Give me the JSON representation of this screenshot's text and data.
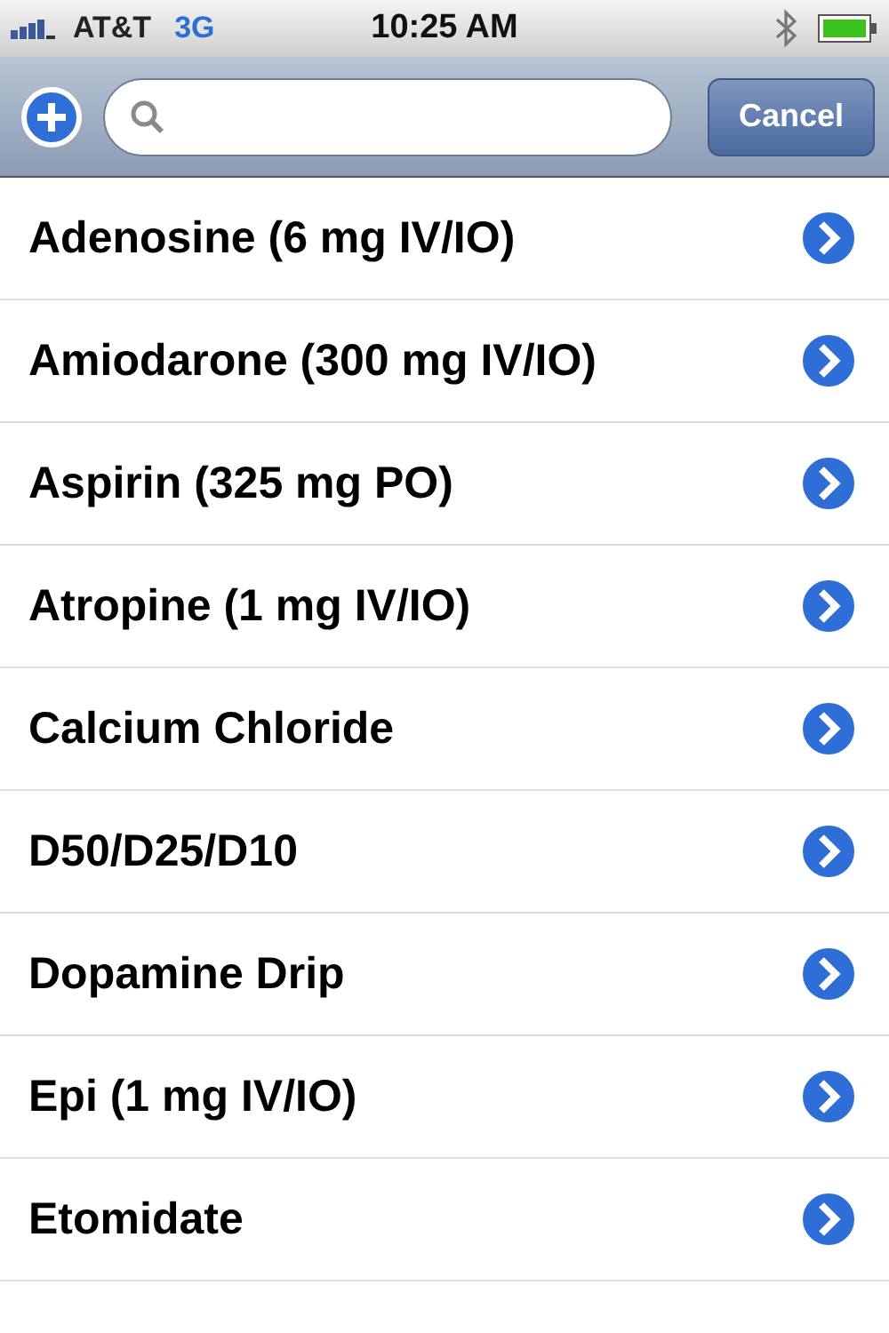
{
  "status_bar": {
    "carrier": "AT&T",
    "network": "3G",
    "time": "10:25 AM"
  },
  "toolbar": {
    "cancel": "Cancel"
  },
  "list": [
    {
      "label": "Adenosine (6 mg IV/IO)"
    },
    {
      "label": "Amiodarone (300 mg IV/IO)"
    },
    {
      "label": "Aspirin (325 mg PO)"
    },
    {
      "label": "Atropine (1 mg IV/IO)"
    },
    {
      "label": "Calcium Chloride"
    },
    {
      "label": "D50/D25/D10"
    },
    {
      "label": "Dopamine Drip"
    },
    {
      "label": "Epi (1 mg IV/IO)"
    },
    {
      "label": "Etomidate"
    }
  ]
}
